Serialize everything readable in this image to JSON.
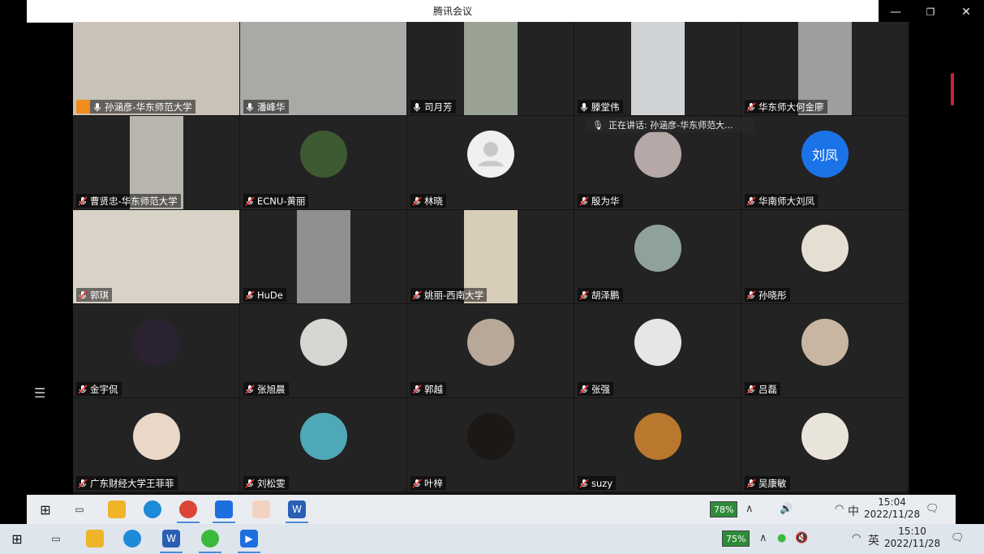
{
  "window": {
    "title": "腾讯会议",
    "controls": {
      "minimize": "—",
      "restore": "❐",
      "close": "✕"
    }
  },
  "speaking_banner": "正在讲话: 孙涵彦-华东师范大...",
  "participants": [
    {
      "name": "孙涵彦-华东师范大学",
      "kind": "video",
      "bg": "#c9c2b8",
      "host": true,
      "mic": "on"
    },
    {
      "name": "潘峰华",
      "kind": "video",
      "bg": "#a9aaa6",
      "mic": "on"
    },
    {
      "name": "司月芳",
      "kind": "video",
      "bg": "#9aa293",
      "mic": "on"
    },
    {
      "name": "滕堂伟",
      "kind": "video",
      "bg": "#cfd3d6",
      "mic": "on"
    },
    {
      "name": "华东师大何金廖",
      "kind": "video",
      "bg": "#9d9f9c",
      "mic": "off"
    },
    {
      "name": "曹贤忠-华东师范大学",
      "kind": "video",
      "bg": "#b8b5ad",
      "mic": "off"
    },
    {
      "name": "ECNU-黄丽",
      "kind": "avatar",
      "bg": "#3d5a32",
      "mic": "off"
    },
    {
      "name": "林晓",
      "kind": "avatar-default",
      "bg": "#f0f0f0",
      "mic": "off"
    },
    {
      "name": "殷为华",
      "kind": "avatar",
      "bg": "#b7a8a8",
      "mic": "off"
    },
    {
      "name": "华南师大刘凤",
      "kind": "avatar-text",
      "avatar_text": "刘凤",
      "bg": "#1b73e8",
      "mic": "off"
    },
    {
      "name": "郭琪",
      "kind": "video",
      "bg": "#d9d3c7",
      "mic": "off"
    },
    {
      "name": "HuDe",
      "kind": "video",
      "bg": "#8e9092",
      "mic": "off"
    },
    {
      "name": "姚丽-西南大学",
      "kind": "video",
      "bg": "#d8cdb8",
      "mic": "off"
    },
    {
      "name": "胡泽鹏",
      "kind": "avatar",
      "bg": "#8fa29a",
      "mic": "off"
    },
    {
      "name": "孙晓彤",
      "kind": "avatar",
      "bg": "#e4dfd2",
      "mic": "off"
    },
    {
      "name": "金宇侃",
      "kind": "avatar",
      "bg": "#2a2230",
      "mic": "off"
    },
    {
      "name": "张旭晨",
      "kind": "avatar",
      "bg": "#d8d6d2",
      "mic": "off"
    },
    {
      "name": "郭越",
      "kind": "avatar",
      "bg": "#b7a89a",
      "mic": "off"
    },
    {
      "name": "张强",
      "kind": "avatar",
      "bg": "#e6e6e6",
      "mic": "off"
    },
    {
      "name": "吕磊",
      "kind": "avatar",
      "bg": "#c8b6a2",
      "mic": "off"
    },
    {
      "name": "广东财经大学王菲菲",
      "kind": "avatar",
      "bg": "#e9d8c8",
      "mic": "off"
    },
    {
      "name": "刘松雯",
      "kind": "avatar",
      "bg": "#4fa8b8",
      "mic": "off"
    },
    {
      "name": "叶梓",
      "kind": "avatar",
      "bg": "#1c1816",
      "mic": "off"
    },
    {
      "name": "suzy",
      "kind": "avatar",
      "bg": "#b9782e",
      "mic": "off"
    },
    {
      "name": "吴康敏",
      "kind": "avatar",
      "bg": "#e8e4da",
      "mic": "off"
    }
  ],
  "taskbar_top": {
    "battery": "78%",
    "ime": "中",
    "time": "15:04",
    "date": "2022/11/28"
  },
  "taskbar_bottom": {
    "battery": "75%",
    "ime": "英",
    "time": "15:10",
    "date": "2022/11/28"
  },
  "colors": {
    "accent": "#1b73e8",
    "host": "#f08c1e",
    "tile_bg": "#232323"
  }
}
